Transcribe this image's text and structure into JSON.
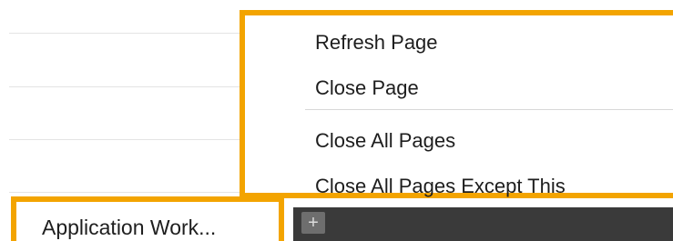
{
  "tabs": {
    "active_label": "Application Work...",
    "add_label": "+"
  },
  "context_menu": {
    "items": [
      {
        "label": "Refresh Page"
      },
      {
        "label": "Close Page"
      },
      {
        "label": "Close All Pages"
      },
      {
        "label": "Close All Pages Except This"
      }
    ]
  },
  "colors": {
    "highlight": "#f3a400",
    "tabbar_dark": "#3a3a3a"
  }
}
